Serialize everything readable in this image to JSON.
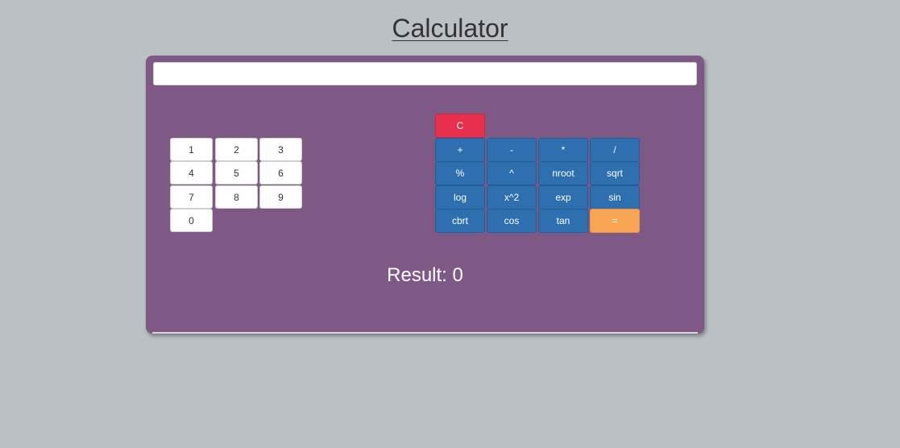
{
  "page": {
    "title": "Calculator"
  },
  "display": {
    "value": "",
    "placeholder": ""
  },
  "number_keys": [
    "1",
    "2",
    "3",
    "4",
    "5",
    "6",
    "7",
    "8",
    "9",
    "0"
  ],
  "operator_keys": {
    "clear": "C",
    "row1": [
      "+",
      "-",
      "*",
      "/"
    ],
    "row2": [
      "%",
      "^",
      "nroot",
      "sqrt"
    ],
    "row3": [
      "log",
      "x^2",
      "exp",
      "sin"
    ],
    "row4": [
      "cbrt",
      "cos",
      "tan",
      "="
    ]
  },
  "result": {
    "text": "Result: 0"
  },
  "colors": {
    "background": "#bac0c3",
    "panel": "#7e5985",
    "operator": "#2e6fb0",
    "clear": "#e8304e",
    "equals": "#f7a553"
  }
}
